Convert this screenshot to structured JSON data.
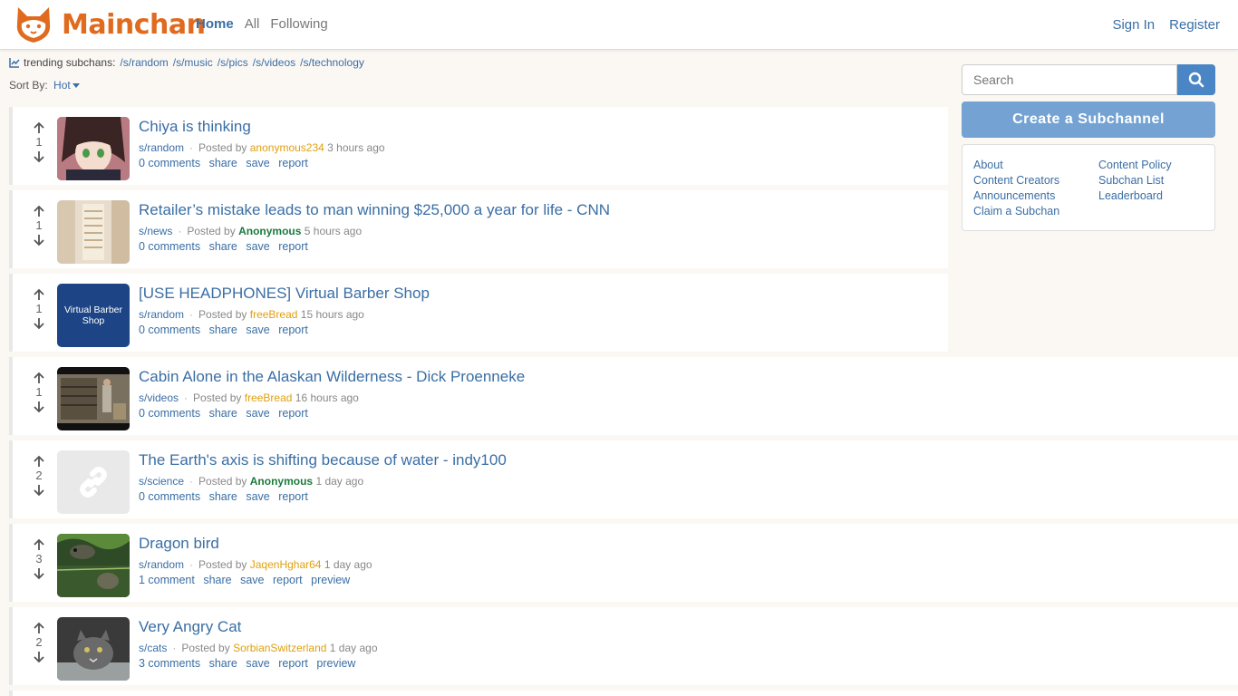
{
  "header": {
    "logo_text": "Mainchan",
    "nav": {
      "home": "Home",
      "all": "All",
      "following": "Following"
    },
    "sign_in": "Sign In",
    "register": "Register"
  },
  "trending": {
    "label": "trending subchans:",
    "items": [
      "/s/random",
      "/s/music",
      "/s/pics",
      "/s/videos",
      "/s/technology"
    ]
  },
  "sort": {
    "label": "Sort By:",
    "value": "Hot"
  },
  "posts": [
    {
      "score": "1",
      "title": "Chiya is thinking",
      "sub": "s/random",
      "posted_by": "Posted by",
      "author": "anonymous234",
      "time": "3 hours ago",
      "comments": "0 comments",
      "share": "share",
      "save": "save",
      "report": "report",
      "preview": ""
    },
    {
      "score": "1",
      "title": "Retailer’s mistake leads to man winning $25,000 a year for life - CNN",
      "sub": "s/news",
      "posted_by": "Posted by",
      "author": "Anonymous",
      "time": "5 hours ago",
      "comments": "0 comments",
      "share": "share",
      "save": "save",
      "report": "report",
      "preview": ""
    },
    {
      "score": "1",
      "title": "[USE HEADPHONES] Virtual Barber Shop",
      "sub": "s/random",
      "posted_by": "Posted by",
      "author": "freeBread",
      "time": "15 hours ago",
      "comments": "0 comments",
      "share": "share",
      "save": "save",
      "report": "report",
      "preview": "",
      "thumb_text": "Virtual Barber Shop"
    },
    {
      "score": "1",
      "title": "Cabin Alone in the Alaskan Wilderness - Dick Proenneke",
      "sub": "s/videos",
      "posted_by": "Posted by",
      "author": "freeBread",
      "time": "16 hours ago",
      "comments": "0 comments",
      "share": "share",
      "save": "save",
      "report": "report",
      "preview": ""
    },
    {
      "score": "2",
      "title": "The Earth's axis is shifting because of water - indy100",
      "sub": "s/science",
      "posted_by": "Posted by",
      "author": "Anonymous",
      "time": "1 day ago",
      "comments": "0 comments",
      "share": "share",
      "save": "save",
      "report": "report",
      "preview": ""
    },
    {
      "score": "3",
      "title": "Dragon bird",
      "sub": "s/random",
      "posted_by": "Posted by",
      "author": "JaqenHghar64",
      "time": "1 day ago",
      "comments": "1 comment",
      "share": "share",
      "save": "save",
      "report": "report",
      "preview": "preview"
    },
    {
      "score": "2",
      "title": "Very Angry Cat",
      "sub": "s/cats",
      "posted_by": "Posted by",
      "author": "SorbianSwitzerland",
      "time": "1 day ago",
      "comments": "3 comments",
      "share": "share",
      "save": "save",
      "report": "report",
      "preview": "preview"
    }
  ],
  "sidebar": {
    "search_placeholder": "Search",
    "create_label": "Create a Subchannel",
    "links_left": [
      "About",
      "Content Creators",
      "Announcements",
      "Claim a Subchan"
    ],
    "links_right": [
      "Content Policy",
      "Subchan List",
      "Leaderboard"
    ]
  },
  "colors": {
    "brand": "#e06b1f",
    "link": "#3a6ea5",
    "button": "#74a3d3"
  }
}
